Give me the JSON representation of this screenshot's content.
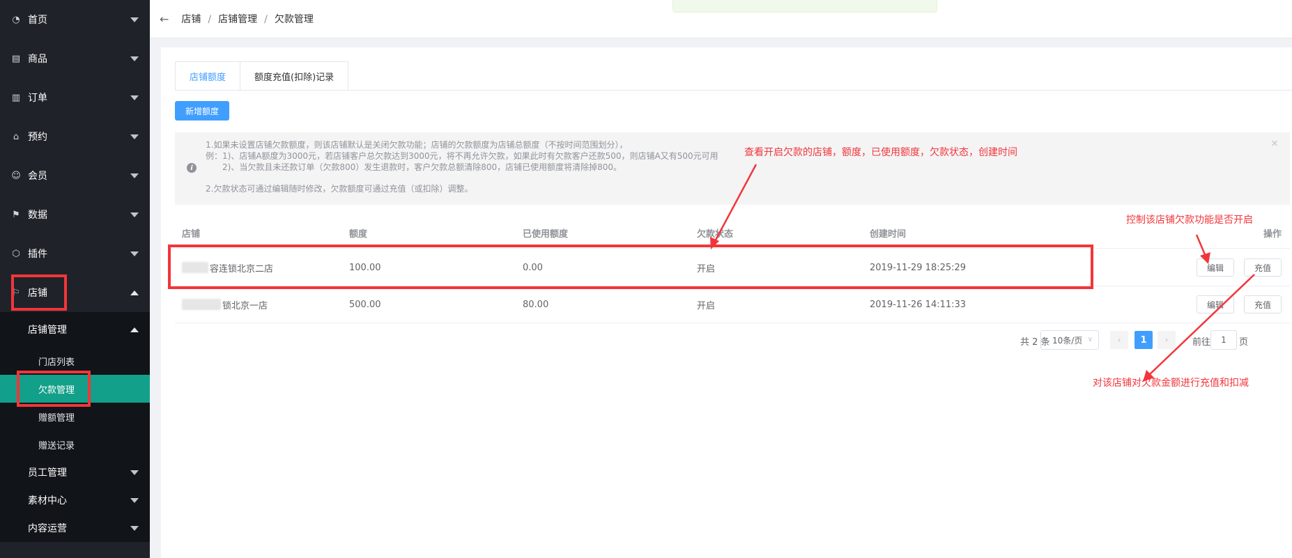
{
  "sidebar": {
    "items": [
      {
        "label": "首页",
        "icon": "dashboard-icon"
      },
      {
        "label": "商品",
        "icon": "goods-icon"
      },
      {
        "label": "订单",
        "icon": "order-icon"
      },
      {
        "label": "预约",
        "icon": "home-icon"
      },
      {
        "label": "会员",
        "icon": "member-icon"
      },
      {
        "label": "数据",
        "icon": "flag-icon"
      },
      {
        "label": "插件",
        "icon": "plugin-icon"
      },
      {
        "label": "店铺",
        "icon": "store-icon"
      }
    ],
    "store_sub_head": "店铺管理",
    "store_sub_items": [
      "门店列表",
      "欠款管理",
      "赠额管理",
      "赠送记录"
    ],
    "more_groups": [
      "员工管理",
      "素材中心",
      "内容运营"
    ]
  },
  "header": {
    "breadcrumb": [
      "店铺",
      "店铺管理",
      "欠款管理"
    ],
    "back_icon": "back-arrow-icon"
  },
  "tabs": [
    {
      "label": "店铺额度",
      "active": true
    },
    {
      "label": "额度充值(扣除)记录",
      "active": false
    }
  ],
  "add_button": "新增额度",
  "notice": {
    "line1": "1.如果未设置店铺欠款额度，则该店铺默认是关闭欠款功能；店铺的欠款额度为店铺总额度（不按时间范围划分），",
    "line2": "例：1)、店铺A额度为3000元，若店铺客户总欠款达到3000元，将不再允许欠款，如果此时有欠款客户还款500，则店铺A又有500元可用",
    "line3": "2)、当欠款且未还款订单（欠款800）发生退款时，客户欠款总额清除800，店铺已使用额度将清除掉800。",
    "line4": "2.欠款状态可通过编辑随时修改，欠款额度可通过充值（或扣除）调整。",
    "close": "×"
  },
  "table": {
    "headers": [
      "店铺",
      "额度",
      "已使用额度",
      "欠款状态",
      "创建时间",
      "操作"
    ],
    "rows": [
      {
        "store": "容连锁北京二店",
        "quota": "100.00",
        "used": "0.00",
        "status": "开启",
        "created": "2019-11-29 18:25:29",
        "edit": "编辑",
        "recharge": "充值"
      },
      {
        "store": "锁北京一店",
        "quota": "500.00",
        "used": "80.00",
        "status": "开启",
        "created": "2019-11-26 14:11:33",
        "edit": "编辑",
        "recharge": "充值"
      }
    ]
  },
  "pagination": {
    "total": "共 2 条",
    "page_size": "10条/页",
    "current_page": "1",
    "goto_label": "前往",
    "goto_value": "1",
    "page_word": "页"
  },
  "annotations": {
    "view": "查看开启欠款的店铺，额度，已使用额度，欠款状态，创建时间",
    "control": "控制该店铺欠款功能是否开启",
    "recharge": "对该店铺对欠款金额进行充值和扣减"
  },
  "colors": {
    "sidebar_bg": "#1f2329",
    "active_item": "#13a08a",
    "primary": "#409eff",
    "annotation_red": "#f2353a"
  }
}
